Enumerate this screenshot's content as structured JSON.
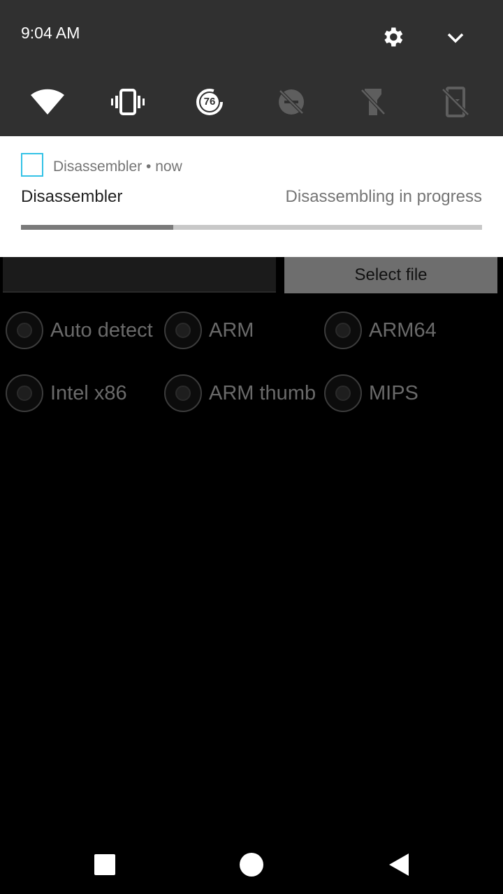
{
  "shade": {
    "time": "9:04 AM",
    "icons": [
      "settings-icon",
      "chevron-down-icon"
    ],
    "tiles": [
      {
        "name": "wifi-tile",
        "icon": "wifi-icon"
      },
      {
        "name": "vibrate-tile",
        "icon": "vibrate-icon"
      },
      {
        "name": "battery-tile",
        "icon": "battery-saver-icon",
        "value": "76"
      },
      {
        "name": "data-saver-tile",
        "icon": "data-saver-off-icon"
      },
      {
        "name": "flashlight-tile",
        "icon": "flashlight-off-icon"
      },
      {
        "name": "rotation-tile",
        "icon": "rotation-lock-icon"
      }
    ]
  },
  "notification": {
    "app_name": "Disassembler",
    "time": "now",
    "title": "Disassembler",
    "text": "Disassembling in progress",
    "progress": 0.33,
    "accent_color": "#33c2e6"
  },
  "app": {
    "file_path_value": "",
    "select_file_label": "Select file",
    "architectures": [
      [
        "Auto detect",
        "ARM",
        "ARM64"
      ],
      [
        "Intel x86",
        "ARM thumb",
        "MIPS"
      ]
    ]
  },
  "navbar": {
    "icons": [
      "recents-icon",
      "home-icon",
      "back-icon"
    ]
  }
}
